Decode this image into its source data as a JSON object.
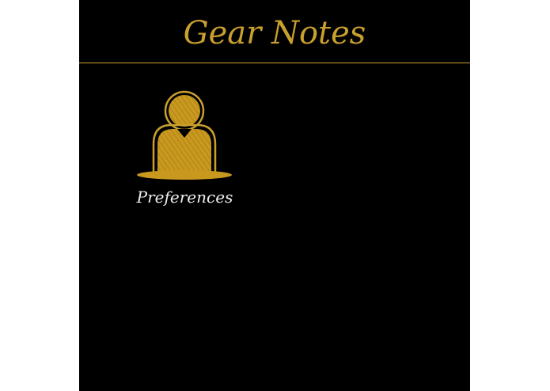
{
  "header": {
    "title": "Gear Notes"
  },
  "tiles": [
    {
      "label": "Preferences",
      "icon": "user-icon"
    }
  ],
  "colors": {
    "background": "#000000",
    "accent": "#c9a02e",
    "label": "#eeeeee"
  }
}
